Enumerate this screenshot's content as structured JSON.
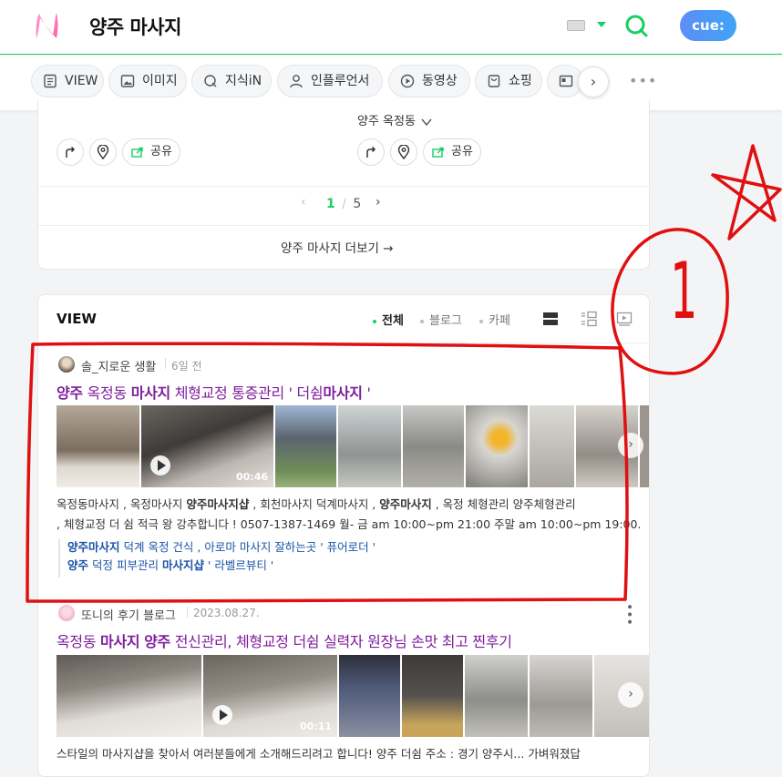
{
  "header": {
    "query": "양주 마사지",
    "cue_label": "cue:"
  },
  "tabs": [
    {
      "label": "VIEW",
      "icon": "document-icon"
    },
    {
      "label": "이미지",
      "icon": "image-icon"
    },
    {
      "label": "지식iN",
      "icon": "q-icon"
    },
    {
      "label": "인플루언서",
      "icon": "person-icon"
    },
    {
      "label": "동영상",
      "icon": "play-icon"
    },
    {
      "label": "쇼핑",
      "icon": "bag-icon"
    }
  ],
  "place": {
    "location_label": "양주 옥정동",
    "share_label": "공유",
    "page_current": "1",
    "page_sep": "/",
    "page_total": "5",
    "more_label": "양주 마사지 더보기 →"
  },
  "view": {
    "heading": "VIEW",
    "filters": [
      "전체",
      "블로그",
      "카페"
    ],
    "posts": [
      {
        "author": "솔_지로운 생활",
        "date": "6일 전",
        "title_parts": [
          "양주",
          " 옥정동 ",
          "마사지",
          " 체형교정 통증관리 ' 더쉼",
          "마사지",
          " '"
        ],
        "video_duration": "00:46",
        "desc_line1_parts": [
          "옥정동마사지 , 옥정마사지 ",
          "양주마사지샵",
          " , 회천마사지 덕계마사지 , ",
          "양주마사지",
          " , 옥정 체형관리 양주체형관리"
        ],
        "desc_line2": ", 체형교정 더 쉼 적극 왕 강추합니다 ! 0507-1387-1469 월- 금 am 10:00~pm 21:00 주말 am 10:00~pm 19:00.",
        "related1_parts": [
          "양주마사지",
          " 덕계 옥정 건식 , 아로마 마사지 잘하는곳 ' 퓨어로더 '"
        ],
        "related2_parts": [
          "양주",
          " 덕정 피부관리 ",
          "마사지샵",
          " ' 라벨르뷰티 '"
        ]
      },
      {
        "author": "또니의 후기 블로그",
        "date": "2023.08.27.",
        "title_parts": [
          "옥정동 ",
          "마사지",
          " ",
          "양주",
          " 전신관리, 체형교정 더쉼 실력자 원장님 손맛 최고 찐후기"
        ],
        "video_duration": "00:11",
        "desc_line1": "스타일의 마사지샵을 찾아서 여러분들에게 소개해드리려고 합니다! 양주 더쉼 주소 : 경기 양주시... 가벼워졌답"
      }
    ]
  },
  "annotation": {
    "number": "1",
    "ink_color": "#e01010"
  },
  "colors": {
    "brand_green": "#19ce60",
    "title_purple": "#7f1d9c",
    "related_blue": "#1a53a6"
  }
}
